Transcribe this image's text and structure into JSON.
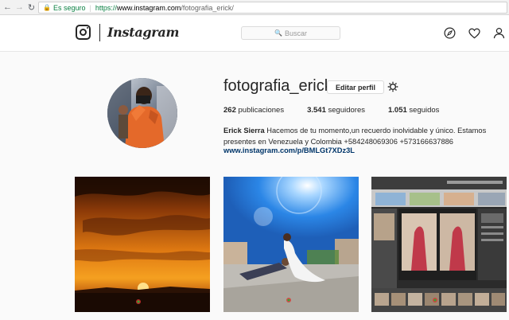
{
  "browser": {
    "secure_label": "Es seguro",
    "url_prefix": "https://",
    "url_host": "www.instagram.com",
    "url_path": "/fotografia_erick/"
  },
  "header": {
    "wordmark": "Instagram",
    "search_placeholder": "Buscar"
  },
  "profile": {
    "username": "fotografia_erick",
    "edit_button": "Editar perfil",
    "stats": {
      "posts_count": "262",
      "posts_label": "publicaciones",
      "followers_count": "3.541",
      "followers_label": "seguidores",
      "following_count": "1.051",
      "following_label": "seguidos"
    },
    "full_name": "Erick Sierra",
    "bio_line1": "Hacemos de tu momento,un recuerdo inolvidable y único. Estamos",
    "bio_line2": "presentes en Venezuela y Colombia +584248069306 +573166637886",
    "link": "www.instagram.com/p/BMLGt7XDz3L"
  },
  "posts": [
    {
      "alt": "sunset-photo"
    },
    {
      "alt": "wedding-couple-photo"
    },
    {
      "alt": "photo-editing-screenshot"
    }
  ],
  "colors": {
    "link": "#003569",
    "secure": "#0b8043",
    "border": "#dbdbdb"
  }
}
